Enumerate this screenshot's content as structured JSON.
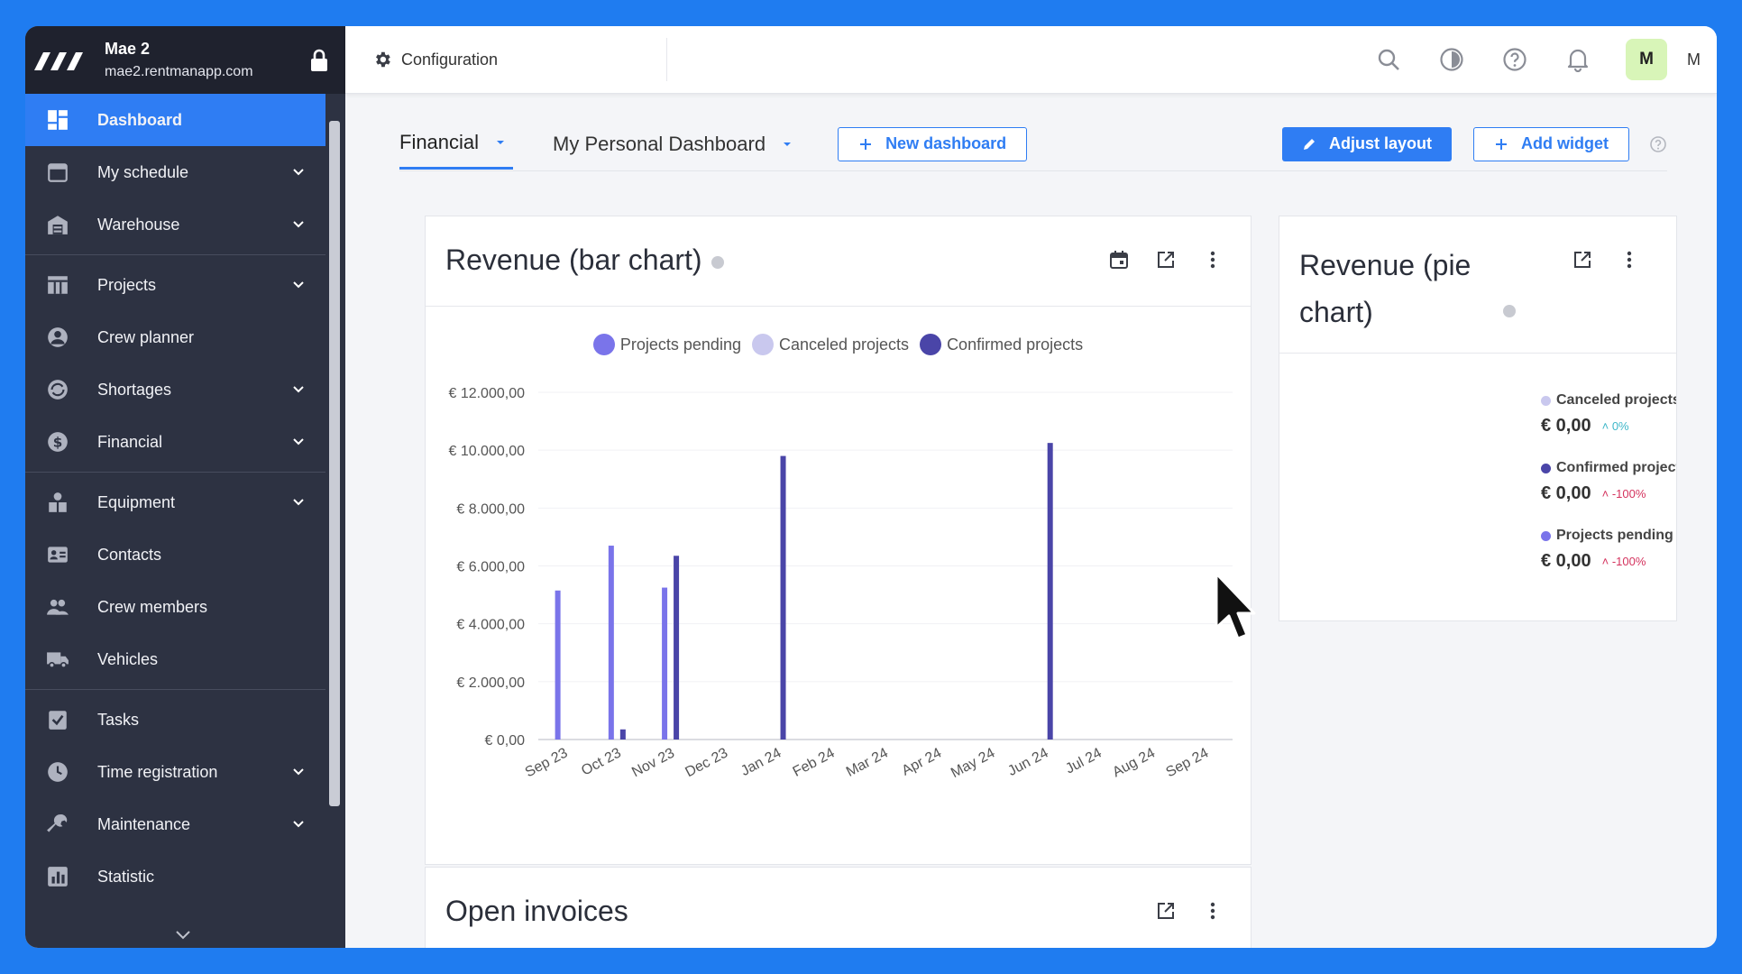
{
  "org": {
    "name": "Mae 2",
    "url": "mae2.rentmanapp.com"
  },
  "nav": [
    {
      "label": "Dashboard",
      "icon": "dashboard-icon",
      "active": true,
      "expand": false
    },
    {
      "label": "My schedule",
      "icon": "calendar-icon",
      "expand": true
    },
    {
      "label": "Warehouse",
      "icon": "warehouse-icon",
      "expand": true
    },
    {
      "sep": true
    },
    {
      "label": "Projects",
      "icon": "projects-icon",
      "expand": true
    },
    {
      "label": "Crew planner",
      "icon": "person-icon",
      "expand": false
    },
    {
      "label": "Shortages",
      "icon": "shortages-icon",
      "expand": true
    },
    {
      "label": "Financial",
      "icon": "dollar-icon",
      "expand": true
    },
    {
      "sep": true
    },
    {
      "label": "Equipment",
      "icon": "equipment-icon",
      "expand": true
    },
    {
      "label": "Contacts",
      "icon": "contacts-icon",
      "expand": false
    },
    {
      "label": "Crew members",
      "icon": "group-icon",
      "expand": false
    },
    {
      "label": "Vehicles",
      "icon": "truck-icon",
      "expand": false
    },
    {
      "sep": true
    },
    {
      "label": "Tasks",
      "icon": "tasks-icon",
      "expand": false
    },
    {
      "label": "Time registration",
      "icon": "clock-icon",
      "expand": true
    },
    {
      "label": "Maintenance",
      "icon": "wrench-icon",
      "expand": true
    },
    {
      "label": "Statistic",
      "icon": "statistic-icon",
      "expand": false
    }
  ],
  "topbar": {
    "crumb": "Configuration",
    "user_initial": "M",
    "user_name": "M"
  },
  "tabs": [
    {
      "label": "Financial",
      "active": true
    },
    {
      "label": "My Personal Dashboard",
      "active": false
    }
  ],
  "buttons": {
    "new_dashboard": "New dashboard",
    "adjust_layout": "Adjust layout",
    "add_widget": "Add widget"
  },
  "bar_card": {
    "title": "Revenue (bar chart)"
  },
  "pie_card": {
    "title_line1": "Revenue (pie",
    "title_line2": "chart)",
    "items": [
      {
        "name": "Canceled projects",
        "color": "#c9c8ee",
        "value": "€ 0,00",
        "change": "0%",
        "change_color": "#3fb7c9"
      },
      {
        "name": "Confirmed project",
        "color": "#4a45a8",
        "value": "€ 0,00",
        "change": "-100%",
        "change_color": "#d4335e"
      },
      {
        "name": "Projects pending",
        "color": "#7a74ea",
        "value": "€ 0,00",
        "change": "-100%",
        "change_color": "#d4335e"
      }
    ]
  },
  "invoices_card": {
    "title": "Open invoices"
  },
  "chart_data": {
    "type": "bar",
    "categories": [
      "Sep 23",
      "Oct 23",
      "Nov 23",
      "Dec 23",
      "Jan 24",
      "Feb 24",
      "Mar 24",
      "Apr 24",
      "May 24",
      "Jun 24",
      "Jul 24",
      "Aug 24",
      "Sep 24"
    ],
    "series": [
      {
        "name": "Projects pending",
        "color": "#7a74ea",
        "values": [
          5150,
          6700,
          5250,
          0,
          0,
          0,
          0,
          0,
          0,
          0,
          0,
          0,
          0
        ]
      },
      {
        "name": "Canceled projects",
        "color": "#c9c8ee",
        "values": [
          0,
          0,
          0,
          0,
          0,
          0,
          0,
          0,
          0,
          0,
          0,
          0,
          0
        ]
      },
      {
        "name": "Confirmed projects",
        "color": "#4a45a8",
        "values": [
          0,
          350,
          6350,
          0,
          9800,
          0,
          0,
          0,
          0,
          10250,
          0,
          0,
          0
        ]
      }
    ],
    "y_ticks": [
      "€ 0,00",
      "€ 2.000,00",
      "€ 4.000,00",
      "€ 6.000,00",
      "€ 8.000,00",
      "€ 10.000,00",
      "€ 12.000,00"
    ],
    "ylim": [
      0,
      12000
    ],
    "grid": true,
    "legend": "top-center"
  }
}
